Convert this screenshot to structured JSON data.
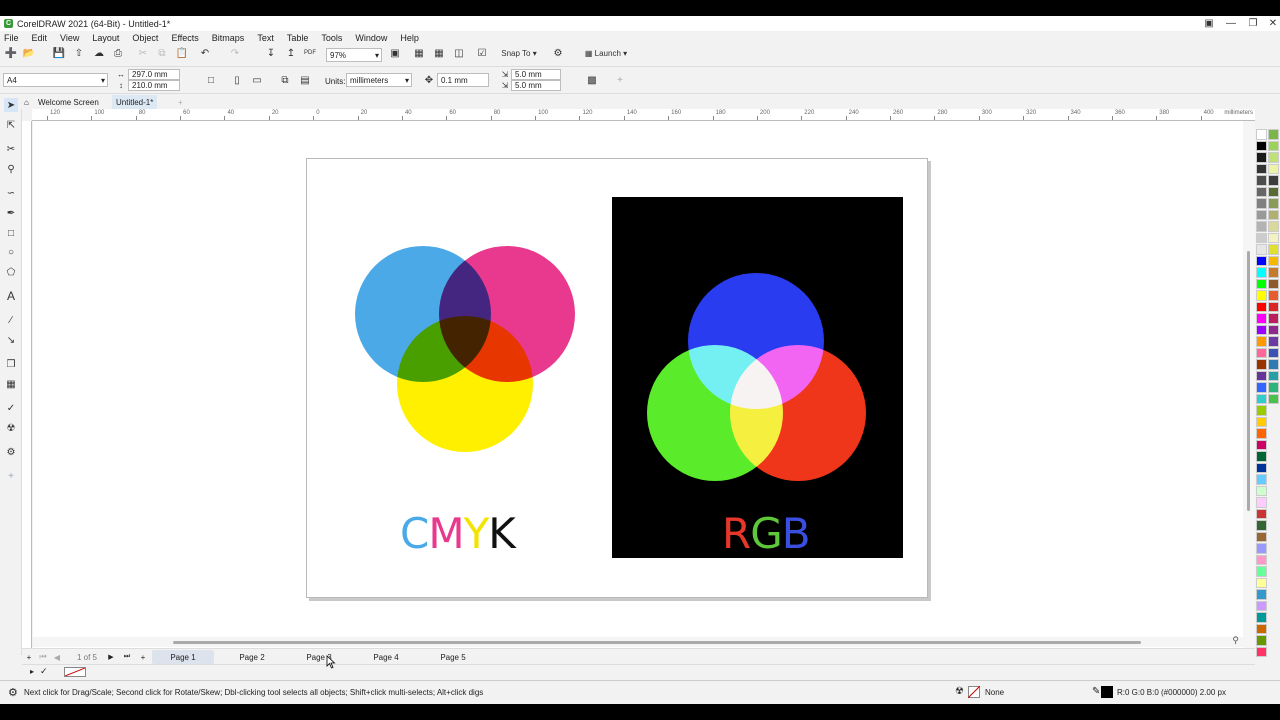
{
  "window": {
    "title": "CorelDRAW 2021 (64-Bit) - Untitled-1*",
    "logo_glyph": "C"
  },
  "menu": [
    "File",
    "Edit",
    "View",
    "Layout",
    "Object",
    "Effects",
    "Bitmaps",
    "Text",
    "Table",
    "Tools",
    "Window",
    "Help"
  ],
  "toolbar": {
    "zoom": "97%",
    "snap_label": "Snap To",
    "launch_label": "Launch"
  },
  "property_bar": {
    "page_size": "A4",
    "width": "297.0 mm",
    "height": "210.0 mm",
    "units_label": "Units:",
    "units_value": "millimeters",
    "nudge": "0.1 mm",
    "dup_x": "5.0 mm",
    "dup_y": "5.0 mm"
  },
  "doc_tabs": {
    "welcome": "Welcome Screen",
    "doc": "Untitled-1*"
  },
  "rulers": {
    "h_ticks": [
      "120",
      "100",
      "80",
      "60",
      "40",
      "20",
      "0",
      "20",
      "40",
      "60",
      "80",
      "100",
      "120",
      "140",
      "160",
      "180",
      "200",
      "220",
      "240",
      "260",
      "280",
      "300",
      "320",
      "340",
      "360",
      "380",
      "400"
    ],
    "unit": "millimeters"
  },
  "artwork": {
    "cmyk_label": [
      "C",
      "M",
      "Y",
      "K"
    ],
    "rgb_label": [
      "R",
      "G",
      "B"
    ],
    "cmyk_colors": {
      "cyan": "#4aa9e6",
      "magenta": "#e8398e",
      "yellow": "#fff000",
      "black": "#111111"
    },
    "rgb_colors": {
      "red": "#e8372a",
      "green": "#5ec83a",
      "blue": "#3a4fe0"
    }
  },
  "page_nav": {
    "counter": "1 of 5",
    "pages": [
      "Page 1",
      "Page 2",
      "Page 3",
      "Page 4",
      "Page 5"
    ],
    "active": "Page 1"
  },
  "status": {
    "hint": "Next click for Drag/Scale; Second click for Rotate/Skew; Dbl-clicking tool selects all objects; Shift+click multi-selects; Alt+click digs",
    "fill": "None",
    "outline": "R:0 G:0 B:0 (#000000) 2.00 px"
  },
  "palette": [
    "#ffffff",
    "#000000",
    "#1a1a1a",
    "#333333",
    "#4d4d4d",
    "#666666",
    "#808080",
    "#999999",
    "#b3b3b3",
    "#cccccc",
    "#e6e6e6",
    "#0000ff",
    "#00ffff",
    "#00ff00",
    "#ffff00",
    "#ff0000",
    "#ff00ff",
    "#9900ff",
    "#ff9900",
    "#ff6699",
    "#993300",
    "#663399",
    "#3366ff",
    "#33cccc",
    "#99cc00",
    "#ffcc00",
    "#ff6600",
    "#cc0066",
    "#006633",
    "#003399",
    "#66ccff",
    "#ccffcc",
    "#ffccff",
    "#cc3333",
    "#336633",
    "#996633",
    "#9999ff",
    "#ff99cc",
    "#66ff99",
    "#ffff99",
    "#3399cc",
    "#cc99ff",
    "#009999",
    "#cc6600",
    "#669900",
    "#ff3366"
  ],
  "palette2": [
    "#7ab648",
    "#9bd35a",
    "#c1e07a",
    "#ecf2a8",
    "#3d3d3d",
    "#596b35",
    "#8a9a5b",
    "#b0b070",
    "#d9d99c",
    "#f2f2c4",
    "#e0e030",
    "#f5b800",
    "#c47b2e",
    "#8c5a2c",
    "#e65c2e",
    "#d92626",
    "#b81f5c",
    "#8c2a8c",
    "#6b3aa3",
    "#3a52b3",
    "#2e7ab3",
    "#26a0a6",
    "#2eb37a",
    "#4dbf4d"
  ]
}
